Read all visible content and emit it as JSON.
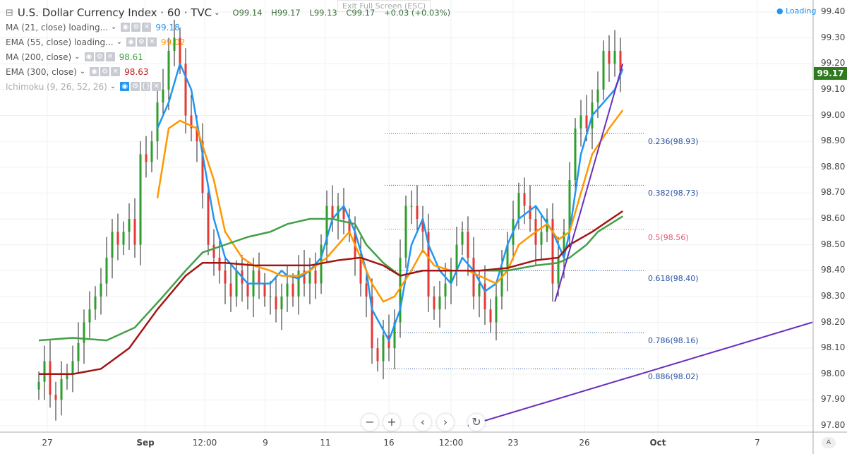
{
  "header": {
    "symbol": "U.S. Dollar Currency Index · 60 · TVC",
    "open": "O99.14",
    "high": "H99.17",
    "low": "L99.13",
    "close": "C99.17",
    "change": "+0.03 (+0.03%)",
    "exit_fullscreen": "Exit Full Screen (ESC)",
    "loading": "● Loading"
  },
  "indicators": [
    {
      "label": "MA (21, close) loading...",
      "value": "99.18",
      "color": "#2196f3"
    },
    {
      "label": "EMA (55, close) loading...",
      "value": "99.02",
      "color": "#ff9800"
    },
    {
      "label": "MA (200, close)",
      "value": "98.61",
      "color": "#43a047"
    },
    {
      "label": "EMA (300, close)",
      "value": "98.63",
      "color": "#b71c1c"
    },
    {
      "label": "Ichimoku (9, 26, 52, 26)",
      "value": "",
      "color": "#999"
    }
  ],
  "price_scale": {
    "labels": [
      "99.40",
      "99.30",
      "99.20",
      "99.10",
      "99.00",
      "98.90",
      "98.80",
      "98.70",
      "98.60",
      "98.50",
      "98.40",
      "98.30",
      "98.20",
      "98.10",
      "98.00",
      "97.90",
      "97.80"
    ],
    "current": "99.17",
    "auto": "A"
  },
  "time_axis": [
    "27",
    "Sep",
    "12:00",
    "9",
    "11",
    "16",
    "12:00",
    "23",
    "26",
    "Oct",
    "7"
  ],
  "nav": {
    "zoom_out": "−",
    "zoom_in": "+",
    "back": "‹",
    "forward": "›",
    "reset": "↻"
  },
  "chart_data": {
    "type": "candlestick",
    "ylim": [
      97.8,
      99.4
    ],
    "closes": [
      97.97,
      98.05,
      97.92,
      97.9,
      97.98,
      98.0,
      98.05,
      98.12,
      98.2,
      98.25,
      98.3,
      98.35,
      98.45,
      98.55,
      98.5,
      98.55,
      98.6,
      98.5,
      98.85,
      98.82,
      98.9,
      99.05,
      99.1,
      99.25,
      99.3,
      99.2,
      99.0,
      98.95,
      98.9,
      98.7,
      98.5,
      98.45,
      98.4,
      98.35,
      98.3,
      98.4,
      98.35,
      98.3,
      98.4,
      98.35,
      98.3,
      98.3,
      98.25,
      98.3,
      98.35,
      98.3,
      98.4,
      98.35,
      98.4,
      98.35,
      98.5,
      98.65,
      98.6,
      98.65,
      98.6,
      98.55,
      98.45,
      98.35,
      98.3,
      98.1,
      98.05,
      98.15,
      98.1,
      98.2,
      98.45,
      98.65,
      98.65,
      98.6,
      98.55,
      98.3,
      98.25,
      98.3,
      98.35,
      98.4,
      98.5,
      98.55,
      98.45,
      98.3,
      98.35,
      98.25,
      98.2,
      98.3,
      98.4,
      98.5,
      98.6,
      98.7,
      98.65,
      98.6,
      98.5,
      98.55,
      98.6,
      98.35,
      98.45,
      98.55,
      98.75,
      98.95,
      99.0,
      98.95,
      99.05,
      99.1,
      99.25,
      99.2,
      99.25,
      99.17
    ],
    "series": [
      {
        "name": "MA 21",
        "color": "#2196f3",
        "points": [
          [
            21,
            98.95
          ],
          [
            23,
            99.05
          ],
          [
            25,
            99.2
          ],
          [
            27,
            99.1
          ],
          [
            29,
            98.85
          ],
          [
            31,
            98.6
          ],
          [
            33,
            98.45
          ],
          [
            35,
            98.4
          ],
          [
            37,
            98.35
          ],
          [
            39,
            98.35
          ],
          [
            41,
            98.35
          ],
          [
            43,
            98.4
          ],
          [
            44,
            98.38
          ],
          [
            46,
            98.37
          ],
          [
            48,
            98.4
          ],
          [
            50,
            98.45
          ],
          [
            52,
            98.6
          ],
          [
            54,
            98.65
          ],
          [
            56,
            98.55
          ],
          [
            58,
            98.4
          ],
          [
            59,
            98.25
          ],
          [
            62,
            98.13
          ],
          [
            64,
            98.25
          ],
          [
            66,
            98.5
          ],
          [
            68,
            98.6
          ],
          [
            69,
            98.5
          ],
          [
            71,
            98.4
          ],
          [
            73,
            98.35
          ],
          [
            75,
            98.45
          ],
          [
            77,
            98.4
          ],
          [
            79,
            98.32
          ],
          [
            81,
            98.35
          ],
          [
            83,
            98.5
          ],
          [
            85,
            98.6
          ],
          [
            88,
            98.65
          ],
          [
            91,
            98.55
          ],
          [
            93,
            98.45
          ],
          [
            94,
            98.55
          ],
          [
            96,
            98.85
          ],
          [
            98,
            99.0
          ],
          [
            100,
            99.05
          ],
          [
            102,
            99.1
          ],
          [
            103.4,
            99.18
          ]
        ]
      },
      {
        "name": "EMA 55",
        "color": "#ff9800",
        "points": [
          [
            21,
            98.68
          ],
          [
            23,
            98.95
          ],
          [
            25,
            98.98
          ],
          [
            28,
            98.95
          ],
          [
            31,
            98.75
          ],
          [
            33,
            98.55
          ],
          [
            36,
            98.45
          ],
          [
            38,
            98.42
          ],
          [
            41,
            98.4
          ],
          [
            43,
            98.38
          ],
          [
            46,
            98.38
          ],
          [
            48,
            98.4
          ],
          [
            51,
            98.45
          ],
          [
            53,
            98.5
          ],
          [
            55,
            98.55
          ],
          [
            57,
            98.45
          ],
          [
            59,
            98.35
          ],
          [
            61,
            98.28
          ],
          [
            63,
            98.3
          ],
          [
            66,
            98.4
          ],
          [
            68,
            98.48
          ],
          [
            70,
            98.42
          ],
          [
            73,
            98.4
          ],
          [
            76,
            98.4
          ],
          [
            78,
            98.38
          ],
          [
            81,
            98.35
          ],
          [
            83,
            98.4
          ],
          [
            85,
            98.5
          ],
          [
            88,
            98.55
          ],
          [
            90,
            98.58
          ],
          [
            92,
            98.52
          ],
          [
            94,
            98.55
          ],
          [
            96,
            98.7
          ],
          [
            98,
            98.85
          ],
          [
            101,
            98.95
          ],
          [
            103.4,
            99.02
          ]
        ]
      },
      {
        "name": "MA 200",
        "color": "#43a047",
        "points": [
          [
            0,
            98.13
          ],
          [
            6,
            98.14
          ],
          [
            12,
            98.13
          ],
          [
            17,
            98.18
          ],
          [
            22,
            98.3
          ],
          [
            26,
            98.4
          ],
          [
            29,
            98.47
          ],
          [
            33,
            98.5
          ],
          [
            37,
            98.53
          ],
          [
            41,
            98.55
          ],
          [
            44,
            98.58
          ],
          [
            48,
            98.6
          ],
          [
            52,
            98.6
          ],
          [
            56,
            98.58
          ],
          [
            58,
            98.5
          ],
          [
            61,
            98.43
          ],
          [
            64,
            98.38
          ],
          [
            68,
            98.4
          ],
          [
            73,
            98.4
          ],
          [
            78,
            98.4
          ],
          [
            83,
            98.4
          ],
          [
            88,
            98.42
          ],
          [
            92,
            98.43
          ],
          [
            94,
            98.45
          ],
          [
            97,
            98.5
          ],
          [
            99,
            98.55
          ],
          [
            103.4,
            98.61
          ]
        ]
      },
      {
        "name": "EMA 300",
        "color": "#a31515",
        "points": [
          [
            0,
            98.0
          ],
          [
            6,
            98.0
          ],
          [
            11,
            98.02
          ],
          [
            16,
            98.1
          ],
          [
            21,
            98.25
          ],
          [
            26,
            98.38
          ],
          [
            29,
            98.43
          ],
          [
            33,
            98.43
          ],
          [
            38,
            98.42
          ],
          [
            43,
            98.42
          ],
          [
            48,
            98.42
          ],
          [
            53,
            98.44
          ],
          [
            57,
            98.45
          ],
          [
            61,
            98.42
          ],
          [
            64,
            98.38
          ],
          [
            68,
            98.4
          ],
          [
            73,
            98.4
          ],
          [
            78,
            98.4
          ],
          [
            83,
            98.41
          ],
          [
            88,
            98.44
          ],
          [
            92,
            98.45
          ],
          [
            94,
            98.5
          ],
          [
            98,
            98.55
          ],
          [
            103.4,
            98.63
          ]
        ]
      }
    ],
    "fibonacci": [
      {
        "label": "0.236(98.93)",
        "price": 98.93,
        "color": "#2952a3"
      },
      {
        "label": "0.382(98.73)",
        "price": 98.73,
        "color": "#2952a3"
      },
      {
        "label": "0.5(98.56)",
        "price": 98.56,
        "color": "#e8567a"
      },
      {
        "label": "0.618(98.40)",
        "price": 98.4,
        "color": "#2952a3"
      },
      {
        "label": "0.786(98.16)",
        "price": 98.16,
        "color": "#2952a3"
      },
      {
        "label": "0.886(98.02)",
        "price": 98.02,
        "color": "#2952a3"
      }
    ],
    "trendlines": [
      {
        "from": [
          91.4,
          98.28
        ],
        "to": [
          103.4,
          99.2
        ],
        "color": "#6a2fc0"
      },
      {
        "from": [
          76,
          97.8
        ],
        "to": [
          137,
          98.2
        ],
        "color": "#6a2fc0"
      }
    ]
  }
}
